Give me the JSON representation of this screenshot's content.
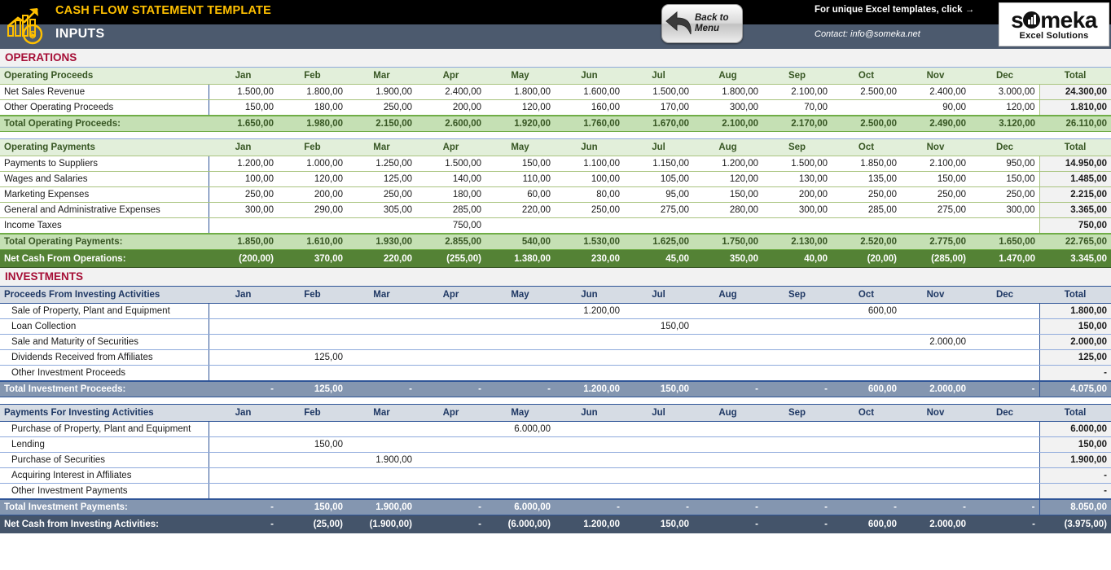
{
  "header": {
    "title": "CASH FLOW STATEMENT TEMPLATE",
    "subtitle": "INPUTS",
    "logo_icon": "growth-chart-dollar-icon",
    "back_button": {
      "line1": "Back to",
      "line2": "Menu",
      "icon": "back-arrow-icon"
    },
    "promo_text": "For unique Excel templates, click →",
    "contact_text": "Contact: info@someka.net",
    "brand": {
      "name": "someka",
      "tagline": "Excel Solutions"
    },
    "colors": {
      "title_gold": "#ffc000",
      "band_top": "#000000",
      "band_bottom": "#4c5a6e",
      "section_red": "#a50d35",
      "green_total": "#c5e0b4",
      "green_net": "#548235",
      "blue_total": "#8496b0",
      "blue_net": "#44546a"
    }
  },
  "months": [
    "Jan",
    "Feb",
    "Mar",
    "Apr",
    "May",
    "Jun",
    "Jul",
    "Aug",
    "Sep",
    "Oct",
    "Nov",
    "Dec"
  ],
  "total_label": "Total",
  "sections": [
    {
      "title": "OPERATIONS",
      "tables": [
        {
          "header": "Operating Proceeds",
          "rows": [
            {
              "label": "Net Sales Revenue",
              "values": [
                "1.500,00",
                "1.800,00",
                "1.900,00",
                "2.400,00",
                "1.800,00",
                "1.600,00",
                "1.500,00",
                "1.800,00",
                "2.100,00",
                "2.500,00",
                "2.400,00",
                "3.000,00"
              ],
              "total": "24.300,00"
            },
            {
              "label": "Other Operating Proceeds",
              "values": [
                "150,00",
                "180,00",
                "250,00",
                "200,00",
                "120,00",
                "160,00",
                "170,00",
                "300,00",
                "70,00",
                "",
                "90,00",
                "120,00"
              ],
              "total": "1.810,00"
            }
          ],
          "total_row": {
            "label": "Total Operating Proceeds:",
            "values": [
              "1.650,00",
              "1.980,00",
              "2.150,00",
              "2.600,00",
              "1.920,00",
              "1.760,00",
              "1.670,00",
              "2.100,00",
              "2.170,00",
              "2.500,00",
              "2.490,00",
              "3.120,00"
            ],
            "total": "26.110,00"
          }
        },
        {
          "header": "Operating Payments",
          "rows": [
            {
              "label": "Payments to Suppliers",
              "values": [
                "1.200,00",
                "1.000,00",
                "1.250,00",
                "1.500,00",
                "150,00",
                "1.100,00",
                "1.150,00",
                "1.200,00",
                "1.500,00",
                "1.850,00",
                "2.100,00",
                "950,00"
              ],
              "total": "14.950,00"
            },
            {
              "label": "Wages and Salaries",
              "values": [
                "100,00",
                "120,00",
                "125,00",
                "140,00",
                "110,00",
                "100,00",
                "105,00",
                "120,00",
                "130,00",
                "135,00",
                "150,00",
                "150,00"
              ],
              "total": "1.485,00"
            },
            {
              "label": "Marketing Expenses",
              "values": [
                "250,00",
                "200,00",
                "250,00",
                "180,00",
                "60,00",
                "80,00",
                "95,00",
                "150,00",
                "200,00",
                "250,00",
                "250,00",
                "250,00"
              ],
              "total": "2.215,00"
            },
            {
              "label": "General and Administrative Expenses",
              "values": [
                "300,00",
                "290,00",
                "305,00",
                "285,00",
                "220,00",
                "250,00",
                "275,00",
                "280,00",
                "300,00",
                "285,00",
                "275,00",
                "300,00"
              ],
              "total": "3.365,00"
            },
            {
              "label": "Income Taxes",
              "values": [
                "",
                "",
                "",
                "750,00",
                "",
                "",
                "",
                "",
                "",
                "",
                "",
                ""
              ],
              "total": "750,00"
            }
          ],
          "total_row": {
            "label": "Total Operating Payments:",
            "values": [
              "1.850,00",
              "1.610,00",
              "1.930,00",
              "2.855,00",
              "540,00",
              "1.530,00",
              "1.625,00",
              "1.750,00",
              "2.130,00",
              "2.520,00",
              "2.775,00",
              "1.650,00"
            ],
            "total": "22.765,00"
          },
          "net_row": {
            "label": "Net Cash From Operations:",
            "values": [
              "(200,00)",
              "370,00",
              "220,00",
              "(255,00)",
              "1.380,00",
              "230,00",
              "45,00",
              "350,00",
              "40,00",
              "(20,00)",
              "(285,00)",
              "1.470,00"
            ],
            "total": "3.345,00"
          }
        }
      ]
    },
    {
      "title": "INVESTMENTS",
      "tables": [
        {
          "header": "Proceeds From Investing Activities",
          "rows": [
            {
              "label": "Sale of Property, Plant and Equipment",
              "values": [
                "",
                "",
                "",
                "",
                "",
                "1.200,00",
                "",
                "",
                "",
                "600,00",
                "",
                ""
              ],
              "total": "1.800,00"
            },
            {
              "label": "Loan Collection",
              "values": [
                "",
                "",
                "",
                "",
                "",
                "",
                "150,00",
                "",
                "",
                "",
                "",
                ""
              ],
              "total": "150,00"
            },
            {
              "label": "Sale and Maturity of Securities",
              "values": [
                "",
                "",
                "",
                "",
                "",
                "",
                "",
                "",
                "",
                "",
                "2.000,00",
                ""
              ],
              "total": "2.000,00"
            },
            {
              "label": "Dividends Received from Affiliates",
              "values": [
                "",
                "125,00",
                "",
                "",
                "",
                "",
                "",
                "",
                "",
                "",
                "",
                ""
              ],
              "total": "125,00"
            },
            {
              "label": "Other Investment Proceeds",
              "values": [
                "",
                "",
                "",
                "",
                "",
                "",
                "",
                "",
                "",
                "",
                "",
                ""
              ],
              "total": "-"
            }
          ],
          "total_row": {
            "label": "Total Investment Proceeds:",
            "values": [
              "-",
              "125,00",
              "-",
              "-",
              "-",
              "1.200,00",
              "150,00",
              "-",
              "-",
              "600,00",
              "2.000,00",
              "-"
            ],
            "total": "4.075,00"
          }
        },
        {
          "header": "Payments For Investing Activities",
          "rows": [
            {
              "label": "Purchase of Property, Plant and Equipment",
              "values": [
                "",
                "",
                "",
                "",
                "6.000,00",
                "",
                "",
                "",
                "",
                "",
                "",
                ""
              ],
              "total": "6.000,00"
            },
            {
              "label": "Lending",
              "values": [
                "",
                "150,00",
                "",
                "",
                "",
                "",
                "",
                "",
                "",
                "",
                "",
                ""
              ],
              "total": "150,00"
            },
            {
              "label": "Purchase of Securities",
              "values": [
                "",
                "",
                "1.900,00",
                "",
                "",
                "",
                "",
                "",
                "",
                "",
                "",
                ""
              ],
              "total": "1.900,00"
            },
            {
              "label": "Acquiring Interest in Affiliates",
              "values": [
                "",
                "",
                "",
                "",
                "",
                "",
                "",
                "",
                "",
                "",
                "",
                ""
              ],
              "total": "-"
            },
            {
              "label": "Other Investment Payments",
              "values": [
                "",
                "",
                "",
                "",
                "",
                "",
                "",
                "",
                "",
                "",
                "",
                ""
              ],
              "total": "-"
            }
          ],
          "total_row": {
            "label": "Total Investment Payments:",
            "values": [
              "-",
              "150,00",
              "1.900,00",
              "-",
              "6.000,00",
              "-",
              "-",
              "-",
              "-",
              "-",
              "-",
              "-"
            ],
            "total": "8.050,00"
          },
          "net_row": {
            "label": "Net Cash from Investing Activities:",
            "values": [
              "-",
              "(25,00)",
              "(1.900,00)",
              "-",
              "(6.000,00)",
              "1.200,00",
              "150,00",
              "-",
              "-",
              "600,00",
              "2.000,00",
              "-"
            ],
            "total": "(3.975,00)"
          }
        }
      ]
    }
  ]
}
